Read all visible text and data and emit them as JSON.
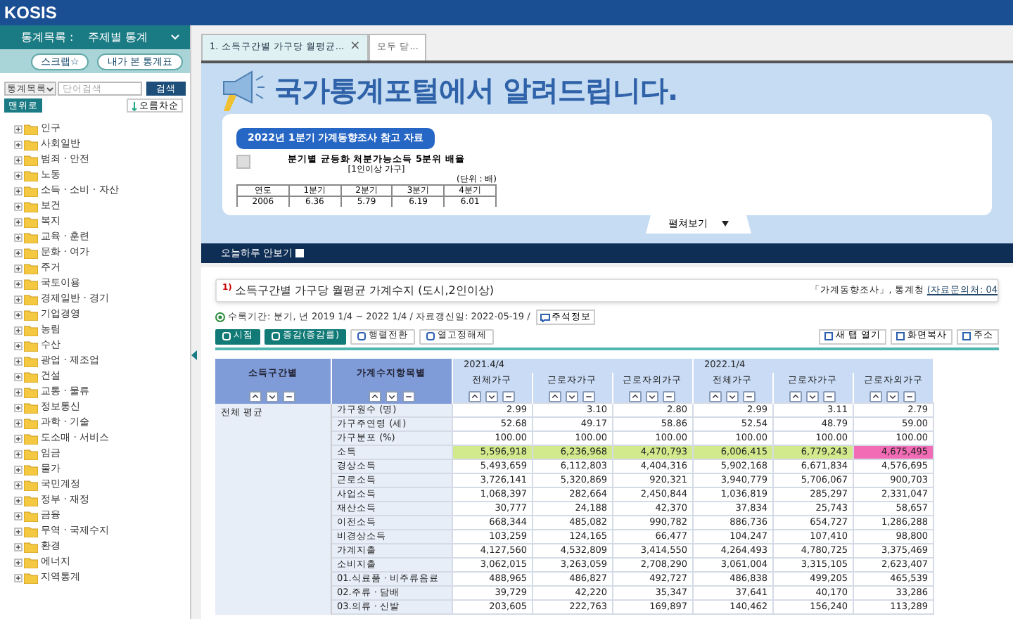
{
  "header": {
    "logo": "KOSIS"
  },
  "sidebar": {
    "menu_label": "통계목록 :",
    "menu_value": "주제별 통계",
    "buttons": [
      "스크랩☆",
      "내가 본 통계표"
    ],
    "search": {
      "scope": "통계목록",
      "placeholder": "단어검색",
      "button": "검색"
    },
    "top_button": "맨위로",
    "sort_button": "오름차순",
    "tree": [
      {
        "label": "인구",
        "expanded": false
      },
      {
        "label": "사회일반",
        "expanded": false
      },
      {
        "label": "범죄 · 안전",
        "expanded": false
      },
      {
        "label": "노동",
        "expanded": false
      },
      {
        "label": "소득 · 소비 · 자산",
        "expanded": false
      },
      {
        "label": "보건",
        "expanded": false
      },
      {
        "label": "복지",
        "expanded": false
      },
      {
        "label": "교육 · 훈련",
        "expanded": false
      },
      {
        "label": "문화 · 여가",
        "expanded": false
      },
      {
        "label": "주거",
        "expanded": false
      },
      {
        "label": "국토이용",
        "expanded": false
      },
      {
        "label": "경제일반 · 경기",
        "expanded": false
      },
      {
        "label": "기업경영",
        "expanded": false
      },
      {
        "label": "농림",
        "expanded": false
      },
      {
        "label": "수산",
        "expanded": false
      },
      {
        "label": "광업 · 제조업",
        "expanded": false
      },
      {
        "label": "건설",
        "expanded": false
      },
      {
        "label": "교통 · 물류",
        "expanded": false
      },
      {
        "label": "정보통신",
        "expanded": false
      },
      {
        "label": "과학 · 기술",
        "expanded": false
      },
      {
        "label": "도소매 · 서비스",
        "expanded": false
      },
      {
        "label": "임금",
        "expanded": false
      },
      {
        "label": "물가",
        "expanded": false
      },
      {
        "label": "국민계정",
        "expanded": false
      },
      {
        "label": "정부 · 재정",
        "expanded": false
      },
      {
        "label": "금융",
        "expanded": false
      },
      {
        "label": "무역 · 국제수지",
        "expanded": false
      },
      {
        "label": "환경",
        "expanded": false
      },
      {
        "label": "에너지",
        "expanded": false
      },
      {
        "label": "지역통계",
        "expanded": false
      }
    ]
  },
  "tabs": [
    {
      "label": "1. 소득구간별 가구당 월평균...",
      "selected": true,
      "close": "×"
    },
    {
      "label": "모두 닫...",
      "selected": false
    }
  ],
  "banner": {
    "heading": "국가통계포털에서 알려드립니다.",
    "badge": "2022년 1분기 가계동향조사 참고 자료",
    "doc_title": "분기별 균등화 처분가능소득 5분위 배율",
    "doc_subtitle": "[1인이상 가구]",
    "doc_unit": "(단위 : 배)",
    "doc_columns": [
      "연도",
      "1분기",
      "2분기",
      "3분기",
      "4분기"
    ],
    "doc_row": [
      "2006",
      "6.36",
      "5.79",
      "6.19",
      "6.01"
    ],
    "expand": "펼쳐보기",
    "hide_today": {
      "label": "오늘하루 안보기",
      "checked": false
    }
  },
  "table_title": {
    "note": "1)",
    "title": "소득구간별 가구당 월평균 가계수지 (도시,2인이상)",
    "source": "「가계동향조사」, 통계청",
    "contact": "(자료문의처: 04"
  },
  "info": {
    "text": "수록기간: 분기, 년 2019 1/4 ~ 2022 1/4 / 자료갱신일: 2022-05-19 /",
    "button": "주석정보"
  },
  "toolbar_left": [
    {
      "label": "시점",
      "kind": "primary"
    },
    {
      "label": "증감(증감률)",
      "kind": "primary"
    },
    {
      "label": "행렬전환",
      "kind": "outline"
    },
    {
      "label": "열고정해제",
      "kind": "outline"
    }
  ],
  "toolbar_right": [
    "새 탭 열기",
    "화면복사",
    "주소"
  ],
  "table": {
    "row_headers": [
      "소득구간별",
      "가계수지항목별"
    ],
    "periods": [
      {
        "label": "2021.4/4",
        "columns": [
          "전체가구",
          "근로자가구",
          "근로자외가구"
        ]
      },
      {
        "label": "2022.1/4",
        "columns": [
          "전체가구",
          "근로자가구",
          "근로자외가구"
        ]
      }
    ],
    "group": "전체 평균",
    "rows": [
      {
        "label": "가구원수 (명)",
        "values": [
          "2.99",
          "3.10",
          "2.80",
          "2.99",
          "3.11",
          "2.79"
        ]
      },
      {
        "label": "가구주연령 (세)",
        "values": [
          "52.68",
          "49.17",
          "58.86",
          "52.54",
          "48.79",
          "59.00"
        ]
      },
      {
        "label": "가구분포 (%)",
        "values": [
          "100.00",
          "100.00",
          "100.00",
          "100.00",
          "100.00",
          "100.00"
        ]
      },
      {
        "label": "소득",
        "values": [
          {
            "text": "5,596,918",
            "color": "#d2ea8c"
          },
          {
            "text": "6,236,968",
            "color": "#d2ea8c"
          },
          {
            "text": "4,470,793",
            "color": "#d2ea8c"
          },
          {
            "text": "6,006,415",
            "color": "#d2ea8c"
          },
          {
            "text": "6,779,243",
            "color": "#d2ea8c"
          },
          {
            "text": "4,675,495",
            "color": "#f26bb5"
          }
        ]
      },
      {
        "label": "경상소득",
        "values": [
          "5,493,659",
          "6,112,803",
          "4,404,316",
          "5,902,168",
          "6,671,834",
          "4,576,695"
        ]
      },
      {
        "label": "근로소득",
        "values": [
          "3,726,141",
          "5,320,869",
          "920,321",
          "3,940,779",
          "5,706,067",
          "900,703"
        ]
      },
      {
        "label": "사업소득",
        "values": [
          "1,068,397",
          "282,664",
          "2,450,844",
          "1,036,819",
          "285,297",
          "2,331,047"
        ]
      },
      {
        "label": "재산소득",
        "values": [
          "30,777",
          "24,188",
          "42,370",
          "37,834",
          "25,743",
          "58,657"
        ]
      },
      {
        "label": "이전소득",
        "values": [
          "668,344",
          "485,082",
          "990,782",
          "886,736",
          "654,727",
          "1,286,288"
        ]
      },
      {
        "label": "비경상소득",
        "values": [
          "103,259",
          "124,165",
          "66,477",
          "104,247",
          "107,410",
          "98,800"
        ]
      },
      {
        "label": "가계지출",
        "values": [
          "4,127,560",
          "4,532,809",
          "3,414,550",
          "4,264,493",
          "4,780,725",
          "3,375,469"
        ]
      },
      {
        "label": "소비지출",
        "values": [
          "3,062,015",
          "3,263,059",
          "2,708,290",
          "3,061,004",
          "3,315,105",
          "2,623,407"
        ]
      },
      {
        "label": "01.식료품 · 비주류음료",
        "values": [
          "488,965",
          "486,827",
          "492,727",
          "486,838",
          "499,205",
          "465,539"
        ]
      },
      {
        "label": "02.주류 · 담배",
        "values": [
          "39,729",
          "42,220",
          "35,347",
          "37,641",
          "40,170",
          "33,286"
        ]
      },
      {
        "label": "03.의류 · 신발",
        "values": [
          "203,605",
          "222,763",
          "169,897",
          "140,462",
          "156,240",
          "113,289"
        ]
      }
    ]
  }
}
